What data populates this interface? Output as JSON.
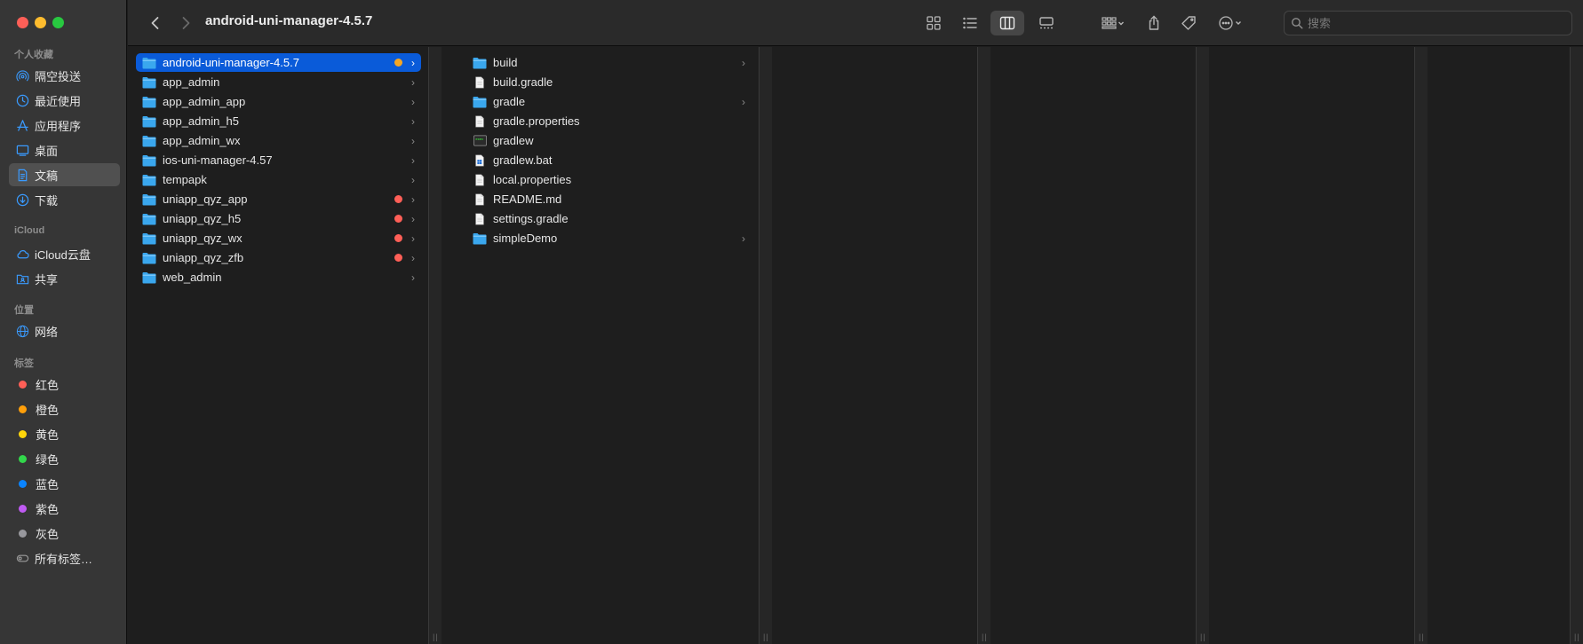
{
  "window": {
    "title": "android-uni-manager-4.5.7"
  },
  "sidebar": {
    "sections": [
      {
        "title": "个人收藏",
        "items": [
          {
            "label": "隔空投送",
            "icon": "airdrop-icon"
          },
          {
            "label": "最近使用",
            "icon": "clock-icon"
          },
          {
            "label": "应用程序",
            "icon": "applications-icon"
          },
          {
            "label": "桌面",
            "icon": "desktop-icon"
          },
          {
            "label": "文稿",
            "icon": "document-icon",
            "active": true
          },
          {
            "label": "下载",
            "icon": "download-icon"
          }
        ]
      },
      {
        "title": "iCloud",
        "items": [
          {
            "label": "iCloud云盘",
            "icon": "cloud-icon"
          },
          {
            "label": "共享",
            "icon": "shared-folder-icon"
          }
        ]
      },
      {
        "title": "位置",
        "items": [
          {
            "label": "网络",
            "icon": "network-icon"
          }
        ]
      },
      {
        "title": "标签",
        "items": [
          {
            "label": "红色",
            "color": "#ff5f57"
          },
          {
            "label": "橙色",
            "color": "#ff9f0a"
          },
          {
            "label": "黄色",
            "color": "#ffd60a"
          },
          {
            "label": "绿色",
            "color": "#32d74b"
          },
          {
            "label": "蓝色",
            "color": "#0a84ff"
          },
          {
            "label": "紫色",
            "color": "#bf5af2"
          },
          {
            "label": "灰色",
            "color": "#98989d"
          },
          {
            "label": "所有标签…",
            "icon": "all-tags-icon"
          }
        ]
      }
    ]
  },
  "toolbar": {
    "search_placeholder": "搜索"
  },
  "columns": [
    {
      "items": [
        {
          "name": "android-uni-manager-4.5.7",
          "type": "folder",
          "selected": true,
          "tag": "#f5a623",
          "has_children": true
        },
        {
          "name": "app_admin",
          "type": "folder",
          "has_children": true
        },
        {
          "name": "app_admin_app",
          "type": "folder",
          "has_children": true
        },
        {
          "name": "app_admin_h5",
          "type": "folder",
          "has_children": true
        },
        {
          "name": "app_admin_wx",
          "type": "folder",
          "has_children": true
        },
        {
          "name": "ios-uni-manager-4.57",
          "type": "folder",
          "has_children": true
        },
        {
          "name": "tempapk",
          "type": "folder",
          "has_children": true
        },
        {
          "name": "uniapp_qyz_app",
          "type": "folder",
          "tag": "#ff5f57",
          "has_children": true
        },
        {
          "name": "uniapp_qyz_h5",
          "type": "folder",
          "tag": "#ff5f57",
          "has_children": true
        },
        {
          "name": "uniapp_qyz_wx",
          "type": "folder",
          "tag": "#ff5f57",
          "has_children": true
        },
        {
          "name": "uniapp_qyz_zfb",
          "type": "folder",
          "tag": "#ff5f57",
          "has_children": true
        },
        {
          "name": "web_admin",
          "type": "folder",
          "has_children": true
        }
      ]
    },
    {
      "items": [
        {
          "name": "build",
          "type": "folder",
          "has_children": true
        },
        {
          "name": "build.gradle",
          "type": "file"
        },
        {
          "name": "gradle",
          "type": "folder",
          "has_children": true
        },
        {
          "name": "gradle.properties",
          "type": "file"
        },
        {
          "name": "gradlew",
          "type": "exec"
        },
        {
          "name": "gradlew.bat",
          "type": "bat"
        },
        {
          "name": "local.properties",
          "type": "file"
        },
        {
          "name": "README.md",
          "type": "file"
        },
        {
          "name": "settings.gradle",
          "type": "file"
        },
        {
          "name": "simpleDemo",
          "type": "folder",
          "has_children": true
        }
      ]
    },
    {
      "items": []
    },
    {
      "items": []
    },
    {
      "items": []
    },
    {
      "items": []
    }
  ],
  "colors": {
    "accent": "#0a5bd9",
    "folder": "#3aa7ee"
  }
}
